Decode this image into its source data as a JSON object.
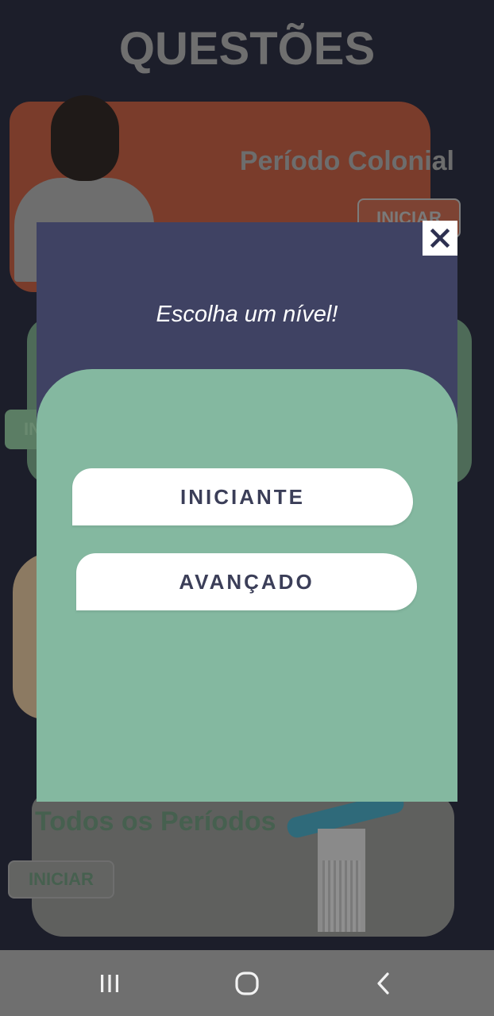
{
  "background": {
    "page_title": "QUESTÕES",
    "cards": [
      {
        "title": "Período Colonial",
        "button_label": "INICIAR"
      },
      {
        "title": "",
        "button_label": "INI"
      },
      {
        "title": "Todos os Períodos",
        "button_label": "INICIAR"
      }
    ]
  },
  "modal": {
    "prompt": "Escolha um nível!",
    "close_icon": "close-icon",
    "levels": [
      {
        "label": "INICIANTE"
      },
      {
        "label": "AVANÇADO"
      }
    ]
  },
  "system_nav": {
    "items": [
      "recent-apps-icon",
      "home-icon",
      "back-icon"
    ]
  },
  "colors": {
    "modal_header": "#3f4263",
    "level_panel": "#84b8a0",
    "button_text": "#3b3e58",
    "background": "#1c1e2a"
  }
}
